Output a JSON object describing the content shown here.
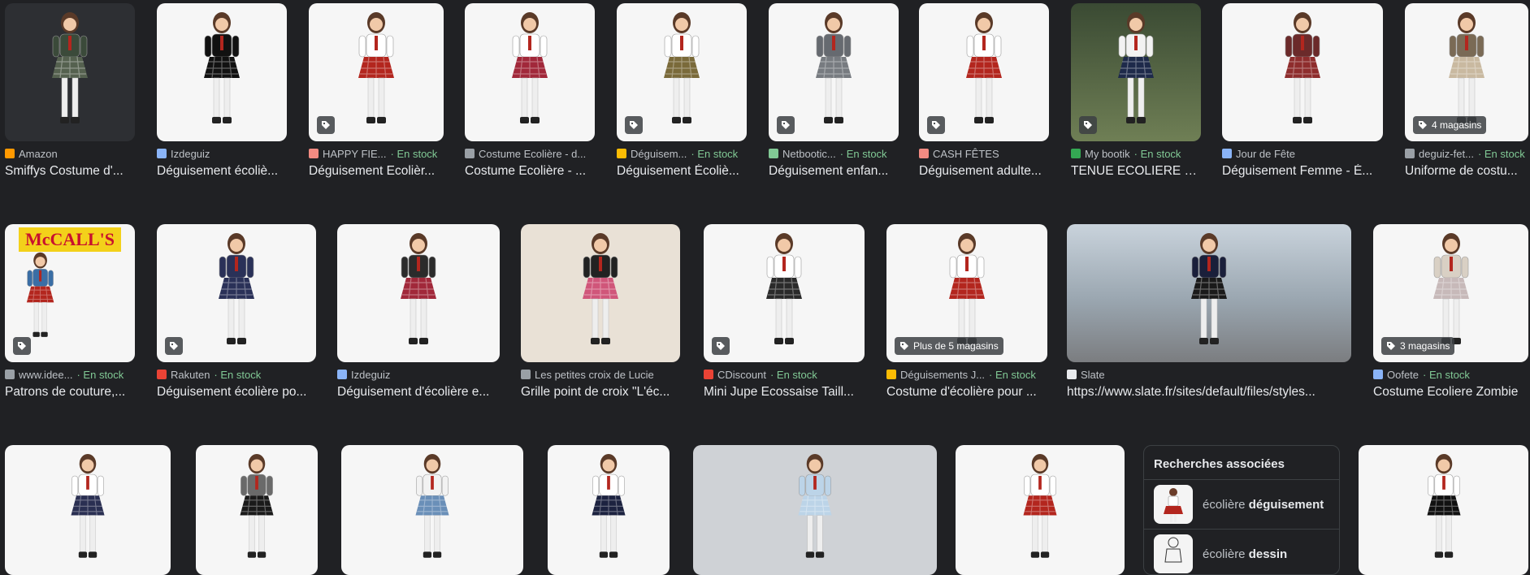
{
  "rows": [
    {
      "cards": [
        {
          "source": "Amazon",
          "stock": "",
          "title": "Smiffys Costume d'...",
          "tag": "",
          "favColor": "#ff9900",
          "bg": "dark",
          "outfit": "#3b4a3a",
          "skirt": "#55614f"
        },
        {
          "source": "Izdeguiz",
          "stock": "",
          "title": "Déguisement écoliè...",
          "tag": "",
          "favColor": "#8ab4f8",
          "bg": "white",
          "outfit": "#111111",
          "skirt": "#111111"
        },
        {
          "source": "HAPPY FIE...",
          "stock": "En stock",
          "title": "Déguisement Ecolièr...",
          "tag": "icon",
          "favColor": "#f28b82",
          "bg": "white",
          "outfit": "#ffffff",
          "skirt": "#b3261e"
        },
        {
          "source": "Costume Ecolière - d...",
          "stock": "",
          "title": "Costume Ecolière - ...",
          "tag": "",
          "favColor": "#9aa0a6",
          "bg": "white",
          "outfit": "#ffffff",
          "skirt": "#a1283a"
        },
        {
          "source": "Déguisem...",
          "stock": "En stock",
          "title": "Déguisement Écoliè...",
          "tag": "icon",
          "favColor": "#fbbc04",
          "bg": "white",
          "outfit": "#ffffff",
          "skirt": "#7a6a3a"
        },
        {
          "source": "Netbootic...",
          "stock": "En stock",
          "title": "Déguisement enfan...",
          "tag": "icon",
          "favColor": "#81c995",
          "bg": "white",
          "outfit": "#666a70",
          "skirt": "#777b80"
        },
        {
          "source": "CASH FÊTES",
          "stock": "",
          "title": "Déguisement adulte...",
          "tag": "icon",
          "favColor": "#f28b82",
          "bg": "white",
          "outfit": "#ffffff",
          "skirt": "#b3261e"
        },
        {
          "source": "My bootik",
          "stock": "En stock",
          "title": "TENUE ECOLIERE B...",
          "tag": "icon",
          "favColor": "#34a853",
          "bg": "green",
          "outfit": "#f2f2f2",
          "skirt": "#1e2a4a"
        },
        {
          "source": "Jour de Fête",
          "stock": "",
          "title": "Déguisement Femme - É...",
          "tag": "",
          "favColor": "#8ab4f8",
          "bg": "white",
          "outfit": "#6b2a2a",
          "skirt": "#8e2d2d"
        },
        {
          "source": "deguiz-fet...",
          "stock": "En stock",
          "title": "Uniforme de costu...",
          "tag": "4 magasins",
          "favColor": "#9aa0a6",
          "bg": "white",
          "outfit": "#7a6a55",
          "skirt": "#c9b9a0"
        }
      ]
    },
    {
      "cards": [
        {
          "source": "www.idee...",
          "stock": "En stock",
          "title": "Patrons de couture,...",
          "tag": "icon",
          "favColor": "#9aa0a6",
          "bg": "white",
          "outfit": "#3a6ea5",
          "skirt": "#b3261e",
          "special": "McCALL'S"
        },
        {
          "source": "Rakuten",
          "stock": "En stock",
          "title": "Déguisement écolière po...",
          "tag": "icon",
          "favColor": "#ea4335",
          "bg": "white",
          "outfit": "#2a3158",
          "skirt": "#2a3158"
        },
        {
          "source": "Izdeguiz",
          "stock": "",
          "title": "Déguisement d'écolière e...",
          "tag": "",
          "favColor": "#8ab4f8",
          "bg": "white",
          "outfit": "#2b2b2b",
          "skirt": "#a1283a"
        },
        {
          "source": "Les petites croix de Lucie",
          "stock": "",
          "title": "Grille point de croix \"L'éc...",
          "tag": "",
          "favColor": "#9aa0a6",
          "bg": "beige",
          "outfit": "#222222",
          "skirt": "#d0567a"
        },
        {
          "source": "CDiscount",
          "stock": "En stock",
          "title": "Mini Jupe Ecossaise Taill...",
          "tag": "icon",
          "favColor": "#ea4335",
          "bg": "white",
          "outfit": "#ffffff",
          "skirt": "#2a2a2a"
        },
        {
          "source": "Déguisements J...",
          "stock": "En stock",
          "title": "Costume d'écolière pour ...",
          "tag": "Plus de 5 magasins",
          "favColor": "#fbbc04",
          "bg": "white",
          "outfit": "#ffffff",
          "skirt": "#b3261e"
        },
        {
          "source": "Slate",
          "stock": "",
          "title": "https://www.slate.fr/sites/default/files/styles...",
          "tag": "",
          "favColor": "#e8eaed",
          "bg": "street",
          "outfit": "#1a1f3a",
          "skirt": "#1a1a1a"
        },
        {
          "source": "Oofete",
          "stock": "En stock",
          "title": "Costume Ecoliere Zombie",
          "tag": "3 magasins",
          "favColor": "#8ab4f8",
          "bg": "white",
          "outfit": "#d9d0c4",
          "skirt": "#c7b9b9"
        }
      ]
    },
    {
      "cards": [
        {
          "bg": "white",
          "outfit": "#ffffff",
          "skirt": "#2a2f52"
        },
        {
          "bg": "white",
          "outfit": "#6a6a6a",
          "skirt": "#1a1a1a"
        },
        {
          "bg": "white",
          "outfit": "#f2f2f2",
          "skirt": "#6a8fb8"
        },
        {
          "bg": "white",
          "outfit": "#ffffff",
          "skirt": "#1c2240"
        },
        {
          "bg": "gray",
          "outfit": "#bcd4e8",
          "skirt": "#bcd4e8"
        },
        {
          "bg": "white",
          "outfit": "#ffffff",
          "skirt": "#b3261e"
        },
        {
          "bg": "white",
          "outfit": "#ffffff",
          "skirt": "#111111"
        }
      ]
    }
  ],
  "related": {
    "heading": "Recherches associées",
    "items": [
      {
        "plain": "écolière ",
        "bold": "déguisement"
      },
      {
        "plain": "écolière ",
        "bold": "dessin"
      }
    ]
  }
}
